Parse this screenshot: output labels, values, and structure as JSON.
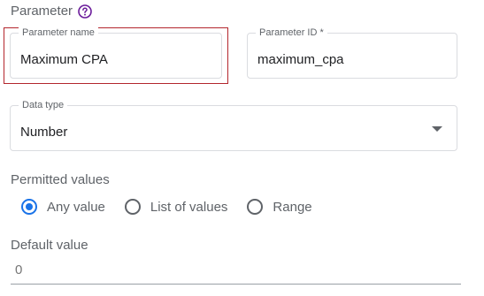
{
  "section": {
    "title": "Parameter",
    "help_icon": "help-circle-icon",
    "accent_color": "#6a1b9a"
  },
  "fields": {
    "parameter_name": {
      "label": "Parameter name",
      "value": "Maximum CPA"
    },
    "parameter_id": {
      "label": "Parameter ID *",
      "value": "maximum_cpa"
    },
    "data_type": {
      "label": "Data type",
      "value": "Number",
      "icon": "dropdown-arrow-icon"
    }
  },
  "permitted_values": {
    "label": "Permitted values",
    "selected_color": "#1a73e8",
    "options": [
      {
        "label": "Any value",
        "checked": true
      },
      {
        "label": "List of values",
        "checked": false
      },
      {
        "label": "Range",
        "checked": false
      }
    ]
  },
  "default_value": {
    "label": "Default value",
    "placeholder": "0"
  },
  "highlight_color": "#b3262d"
}
